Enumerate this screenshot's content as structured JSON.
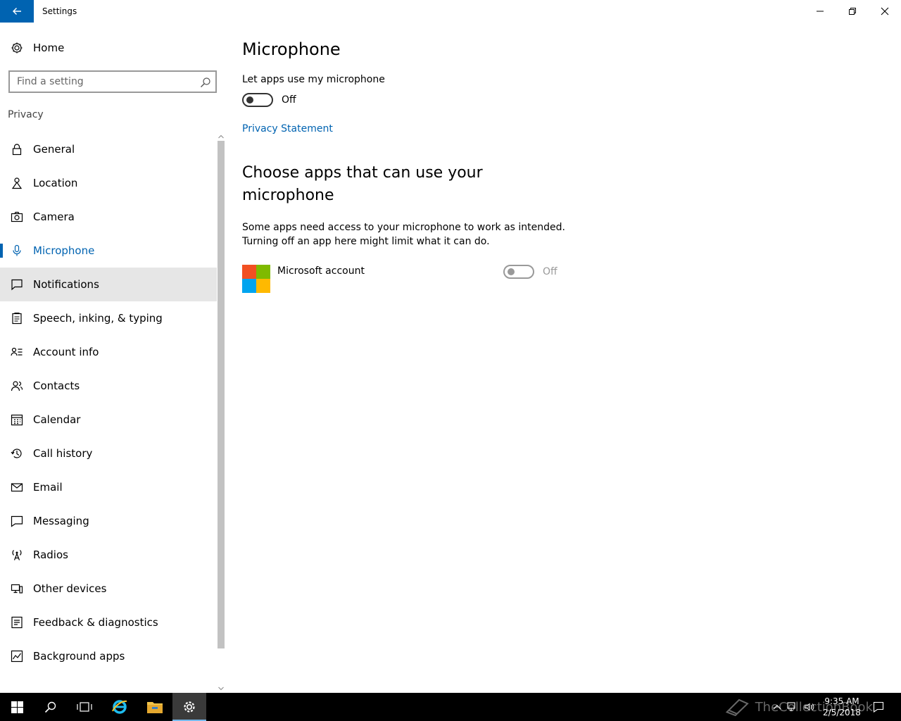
{
  "window": {
    "title": "Settings"
  },
  "sidebar": {
    "home_label": "Home",
    "search_placeholder": "Find a setting",
    "section_label": "Privacy",
    "items": [
      {
        "label": "General",
        "icon": "lock-icon"
      },
      {
        "label": "Location",
        "icon": "location-icon"
      },
      {
        "label": "Camera",
        "icon": "camera-icon"
      },
      {
        "label": "Microphone",
        "icon": "microphone-icon"
      },
      {
        "label": "Notifications",
        "icon": "notification-icon"
      },
      {
        "label": "Speech, inking, & typing",
        "icon": "speech-icon"
      },
      {
        "label": "Account info",
        "icon": "account-info-icon"
      },
      {
        "label": "Contacts",
        "icon": "contacts-icon"
      },
      {
        "label": "Calendar",
        "icon": "calendar-icon"
      },
      {
        "label": "Call history",
        "icon": "history-icon"
      },
      {
        "label": "Email",
        "icon": "email-icon"
      },
      {
        "label": "Messaging",
        "icon": "messaging-icon"
      },
      {
        "label": "Radios",
        "icon": "radio-icon"
      },
      {
        "label": "Other devices",
        "icon": "devices-icon"
      },
      {
        "label": "Feedback & diagnostics",
        "icon": "feedback-icon"
      },
      {
        "label": "Background apps",
        "icon": "background-apps-icon"
      }
    ],
    "active_item": "Microphone",
    "hover_item": "Notifications"
  },
  "main": {
    "title": "Microphone",
    "toggle_label": "Let apps use my microphone",
    "toggle_state": "Off",
    "privacy_link": "Privacy Statement",
    "section_title": "Choose apps that can use your microphone",
    "description_line1": "Some apps need access to your microphone to work as intended.",
    "description_line2": "Turning off an app here might limit what it can do.",
    "apps": [
      {
        "name": "Microsoft account",
        "state": "Off",
        "enabled": false
      }
    ]
  },
  "taskbar": {
    "clock_time": "9:35 AM",
    "clock_date": "2/5/2018",
    "watermark": "TheCollectionBook"
  },
  "colors": {
    "accent": "#0063b1",
    "hover": "#e6e6e6",
    "taskbar": "#000000",
    "ms_red": "#f25022",
    "ms_green": "#7fba00",
    "ms_blue": "#00a4ef",
    "ms_yellow": "#ffb900"
  }
}
